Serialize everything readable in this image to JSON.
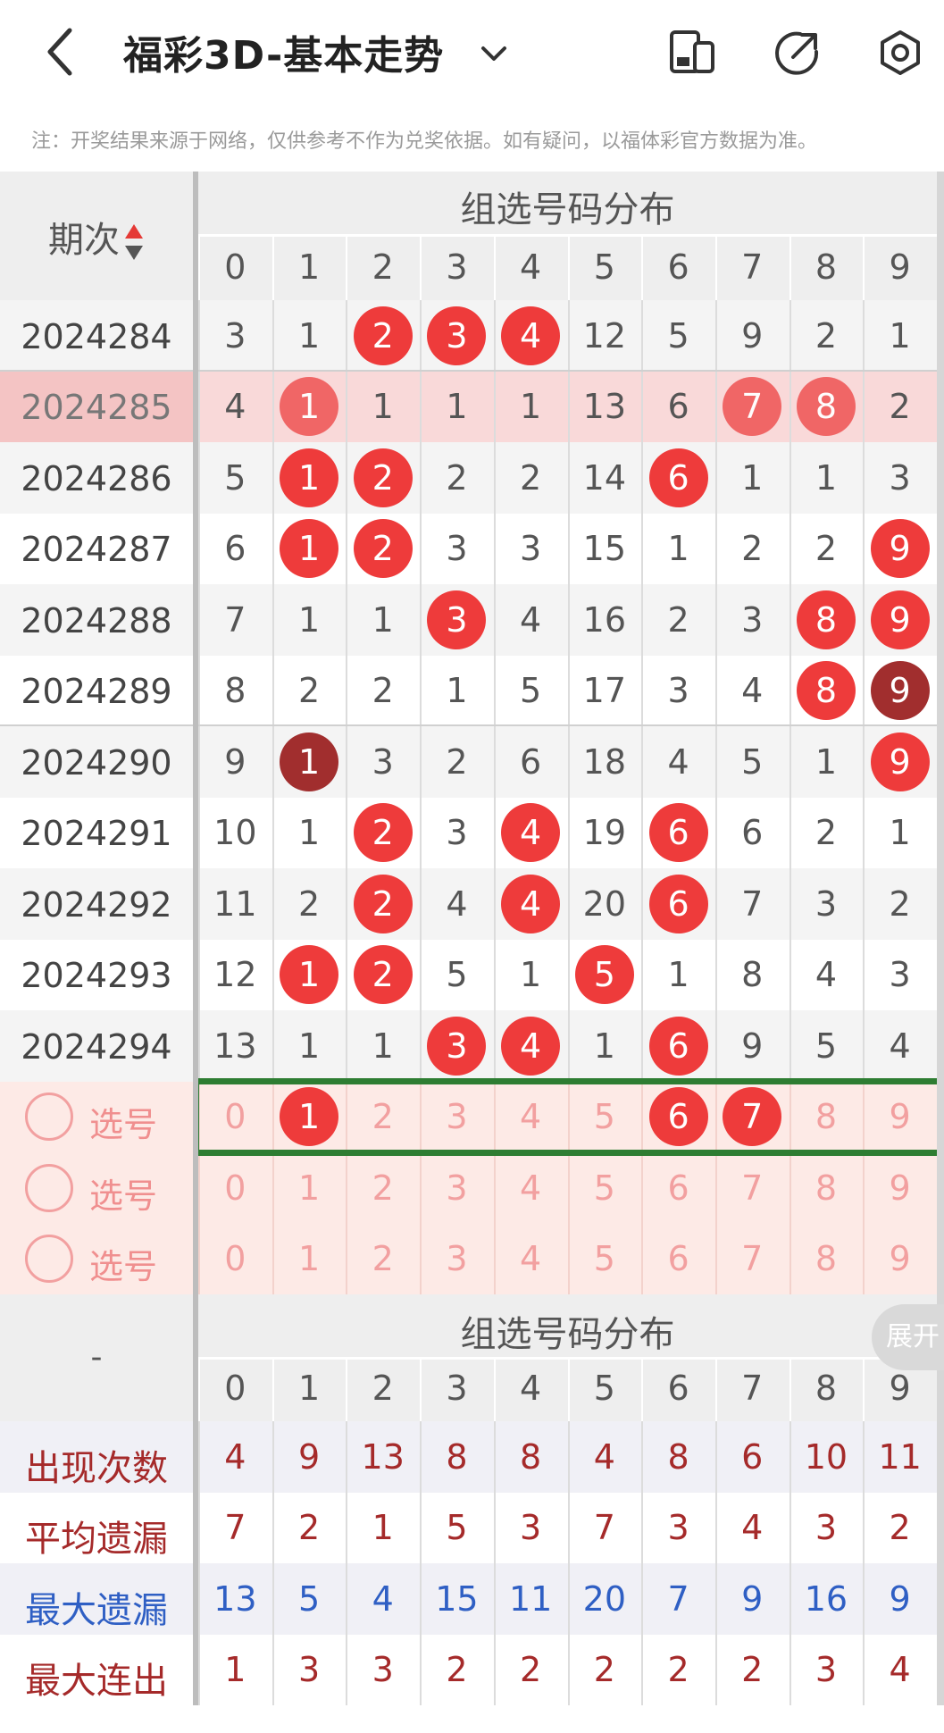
{
  "header": {
    "title": "福彩3D-基本走势",
    "icons": [
      "back-icon",
      "chevron-down-icon",
      "device-icon",
      "share-icon",
      "settings-icon"
    ]
  },
  "notice": "注：开奖结果来源于网络，仅供参考不作为兑奖依据。如有疑问，以福体彩官方数据为准。",
  "table": {
    "group_title": "组选号码分布",
    "period_header": "期次",
    "digits": [
      "0",
      "1",
      "2",
      "3",
      "4",
      "5",
      "6",
      "7",
      "8",
      "9"
    ],
    "rows": [
      {
        "period": "2024284",
        "cells": [
          "3",
          "1",
          "2",
          "3",
          "4",
          "12",
          "5",
          "9",
          "2",
          "1"
        ],
        "balls": [
          2,
          3,
          4
        ],
        "dark": [],
        "highlight": false
      },
      {
        "period": "2024285",
        "cells": [
          "4",
          "1",
          "1",
          "1",
          "1",
          "13",
          "6",
          "7",
          "8",
          "2"
        ],
        "balls": [
          1,
          7,
          8
        ],
        "dark": [],
        "highlight": true
      },
      {
        "period": "2024286",
        "cells": [
          "5",
          "1",
          "2",
          "2",
          "2",
          "14",
          "6",
          "1",
          "1",
          "3"
        ],
        "balls": [
          1,
          2,
          6
        ],
        "dark": [],
        "highlight": false
      },
      {
        "period": "2024287",
        "cells": [
          "6",
          "1",
          "2",
          "3",
          "3",
          "15",
          "1",
          "2",
          "2",
          "9"
        ],
        "balls": [
          1,
          2,
          9
        ],
        "dark": [],
        "highlight": false
      },
      {
        "period": "2024288",
        "cells": [
          "7",
          "1",
          "1",
          "3",
          "4",
          "16",
          "2",
          "3",
          "8",
          "9"
        ],
        "balls": [
          3,
          8,
          9
        ],
        "dark": [],
        "highlight": false
      },
      {
        "period": "2024289",
        "cells": [
          "8",
          "2",
          "2",
          "1",
          "5",
          "17",
          "3",
          "4",
          "8",
          "9"
        ],
        "balls": [
          8
        ],
        "dark": [
          9
        ],
        "highlight": false
      },
      {
        "period": "2024290",
        "cells": [
          "9",
          "1",
          "3",
          "2",
          "6",
          "18",
          "4",
          "5",
          "1",
          "9"
        ],
        "balls": [
          9
        ],
        "dark": [
          1
        ],
        "highlight": false
      },
      {
        "period": "2024291",
        "cells": [
          "10",
          "1",
          "2",
          "3",
          "4",
          "19",
          "6",
          "6",
          "2",
          "1"
        ],
        "balls": [
          2,
          4,
          6
        ],
        "dark": [],
        "highlight": false
      },
      {
        "period": "2024292",
        "cells": [
          "11",
          "2",
          "2",
          "4",
          "4",
          "20",
          "6",
          "7",
          "3",
          "2"
        ],
        "balls": [
          2,
          4,
          6
        ],
        "dark": [],
        "highlight": false
      },
      {
        "period": "2024293",
        "cells": [
          "12",
          "1",
          "2",
          "5",
          "1",
          "5",
          "1",
          "8",
          "4",
          "3"
        ],
        "balls": [
          1,
          2,
          5
        ],
        "dark": [],
        "highlight": false
      },
      {
        "period": "2024294",
        "cells": [
          "13",
          "1",
          "1",
          "3",
          "4",
          "1",
          "6",
          "9",
          "5",
          "4"
        ],
        "balls": [
          3,
          4,
          6
        ],
        "dark": [],
        "highlight": false
      }
    ],
    "pick_label": "选号",
    "pick_rows": [
      {
        "balls": [
          1,
          6,
          7
        ]
      },
      {
        "balls": []
      },
      {
        "balls": []
      }
    ],
    "stats_left_header": "-",
    "expand_label": "展开",
    "stats": [
      {
        "label": "出现次数",
        "color": "#a52a2a",
        "values": [
          "4",
          "9",
          "13",
          "8",
          "8",
          "4",
          "8",
          "6",
          "10",
          "11"
        ]
      },
      {
        "label": "平均遗漏",
        "color": "#a52a2a",
        "values": [
          "7",
          "2",
          "1",
          "5",
          "3",
          "7",
          "3",
          "4",
          "3",
          "2"
        ]
      },
      {
        "label": "最大遗漏",
        "color": "#2f5fc4",
        "values": [
          "13",
          "5",
          "4",
          "15",
          "11",
          "20",
          "7",
          "9",
          "16",
          "9"
        ]
      },
      {
        "label": "最大连出",
        "color": "#a52a2a",
        "values": [
          "1",
          "3",
          "3",
          "2",
          "2",
          "2",
          "2",
          "2",
          "3",
          "4"
        ]
      }
    ]
  }
}
